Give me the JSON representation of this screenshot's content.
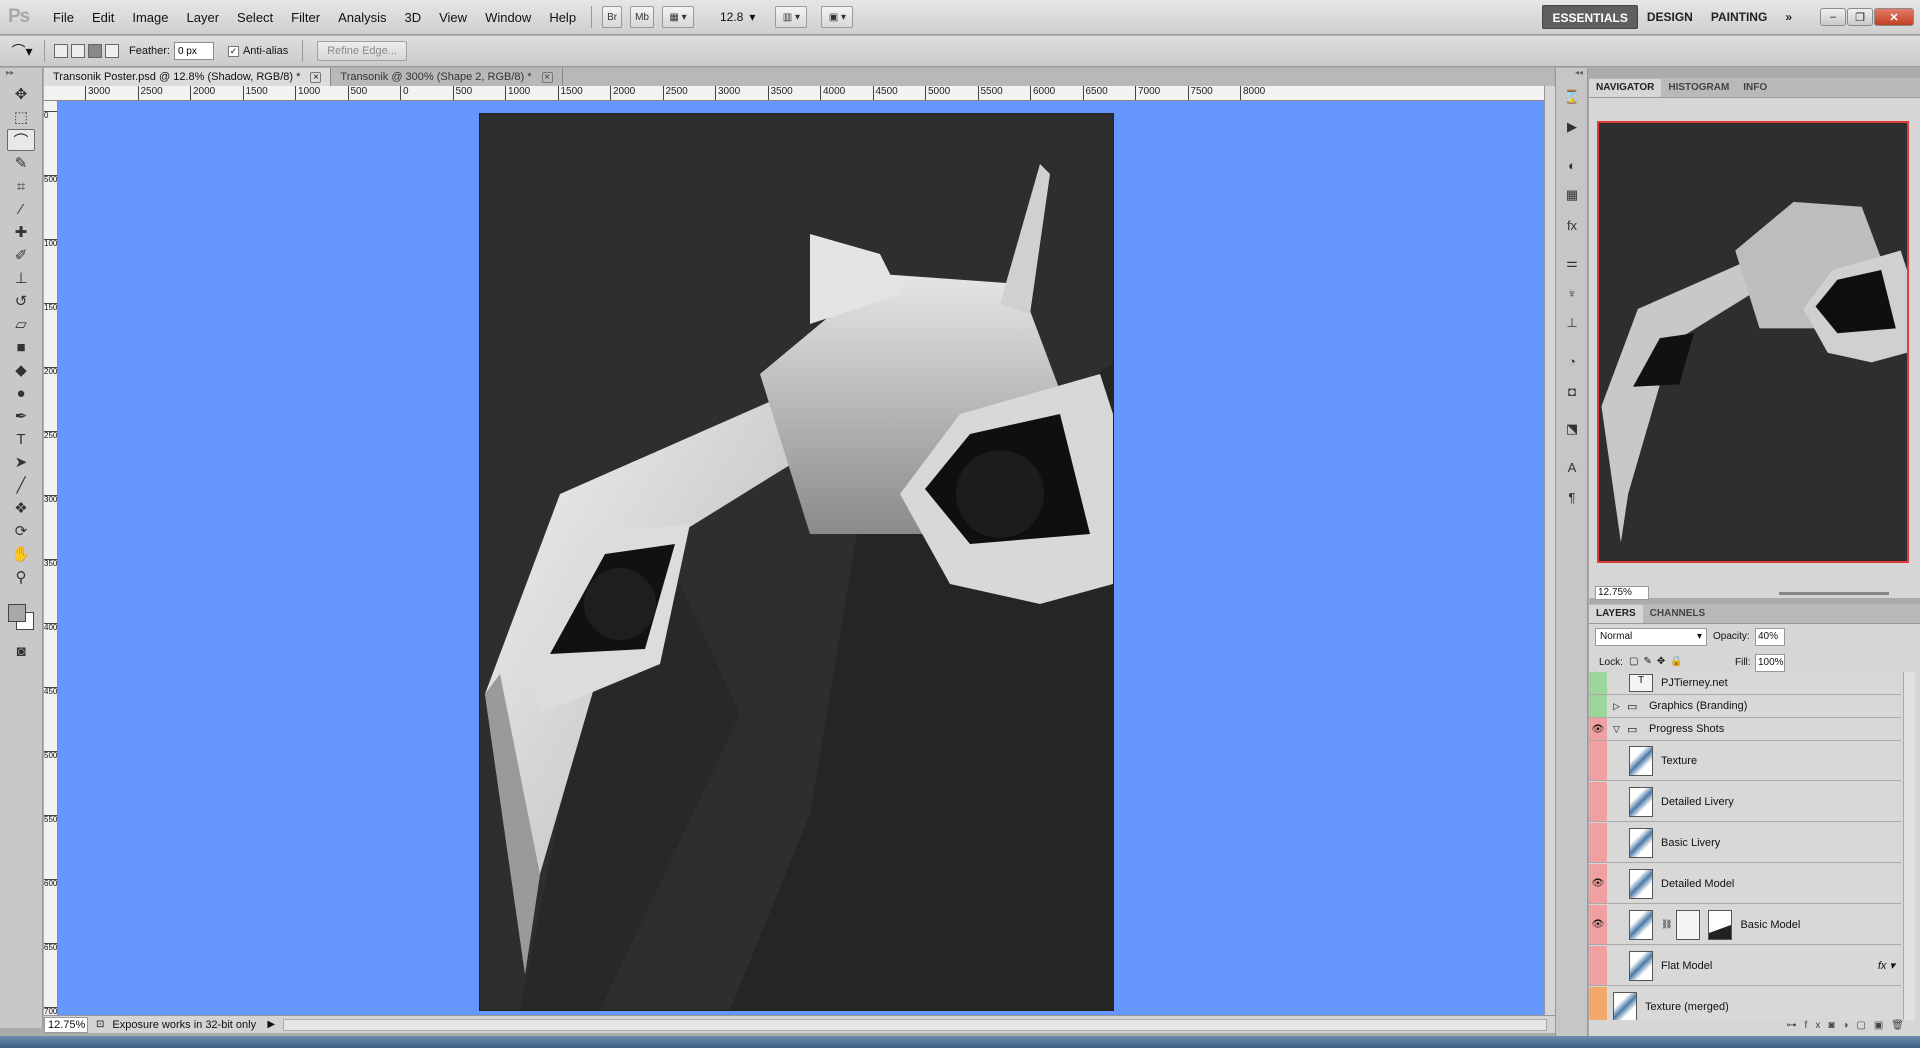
{
  "app": {
    "logo": "Ps"
  },
  "menu": [
    "File",
    "Edit",
    "Image",
    "Layer",
    "Select",
    "Filter",
    "Analysis",
    "3D",
    "View",
    "Window",
    "Help"
  ],
  "menubar_buttons": {
    "bridge": "Br",
    "mini_bridge": "Mb",
    "zoom": "12.8"
  },
  "workspaces": [
    "ESSENTIALS",
    "DESIGN",
    "PAINTING"
  ],
  "options": {
    "feather_label": "Feather:",
    "feather_value": "0 px",
    "antialias_label": "Anti-alias",
    "refine_edge": "Refine Edge..."
  },
  "tabs": [
    {
      "title": "Transonik Poster.psd @ 12.8% (Shadow, RGB/8) *",
      "active": true
    },
    {
      "title": "Transonik @ 300% (Shape 2, RGB/8) *",
      "active": false
    }
  ],
  "ruler_h": [
    "3000",
    "2500",
    "2000",
    "1500",
    "1000",
    "500",
    "0",
    "500",
    "1000",
    "1500",
    "2000",
    "2500",
    "3000",
    "3500",
    "4000",
    "4500",
    "5000",
    "5500",
    "6000",
    "6500",
    "7000",
    "7500",
    "8000"
  ],
  "ruler_v": [
    "0",
    "500",
    "1000",
    "1500",
    "2000",
    "2500",
    "3000",
    "3500",
    "4000",
    "4500",
    "5000",
    "5500",
    "6000",
    "6500",
    "7000"
  ],
  "status": {
    "zoom": "12.75%",
    "message": "Exposure works in 32-bit only"
  },
  "navigator": {
    "tabs": [
      "NAVIGATOR",
      "HISTOGRAM",
      "INFO"
    ],
    "zoom": "12.75%"
  },
  "layers_panel": {
    "tabs": [
      "LAYERS",
      "CHANNELS"
    ],
    "blend_mode": "Normal",
    "opacity_label": "Opacity:",
    "opacity": "40%",
    "lock_label": "Lock:",
    "fill_label": "Fill:",
    "fill": "100%",
    "layers": [
      {
        "name": "PJTierney.net",
        "type": "text",
        "color": "#9bd79b",
        "visible": false
      },
      {
        "name": "Graphics (Branding)",
        "type": "group",
        "color": "#9bd79b",
        "visible": false
      },
      {
        "name": "Progress Shots",
        "type": "group-open",
        "color": "#f0a0a0",
        "visible": true
      },
      {
        "name": "Texture",
        "type": "layer",
        "color": "#f0a0a0",
        "visible": false
      },
      {
        "name": "Detailed Livery",
        "type": "layer",
        "color": "#f0a0a0",
        "visible": false
      },
      {
        "name": "Basic Livery",
        "type": "layer",
        "color": "#f0a0a0",
        "visible": false
      },
      {
        "name": "Detailed Model",
        "type": "layer",
        "color": "#f0a0a0",
        "visible": true
      },
      {
        "name": "Basic Model",
        "type": "layer-mask",
        "color": "#f0a0a0",
        "visible": true
      },
      {
        "name": "Flat Model",
        "type": "layer-fx",
        "color": "#f0a0a0",
        "visible": false
      },
      {
        "name": "Texture (merged)",
        "type": "layer",
        "color": "#f2a86a",
        "visible": false
      }
    ]
  },
  "colors": {
    "canvas_bg": "#6697ff",
    "doc_bg": "#2e2e2e",
    "accent_close": "#c13e22"
  }
}
